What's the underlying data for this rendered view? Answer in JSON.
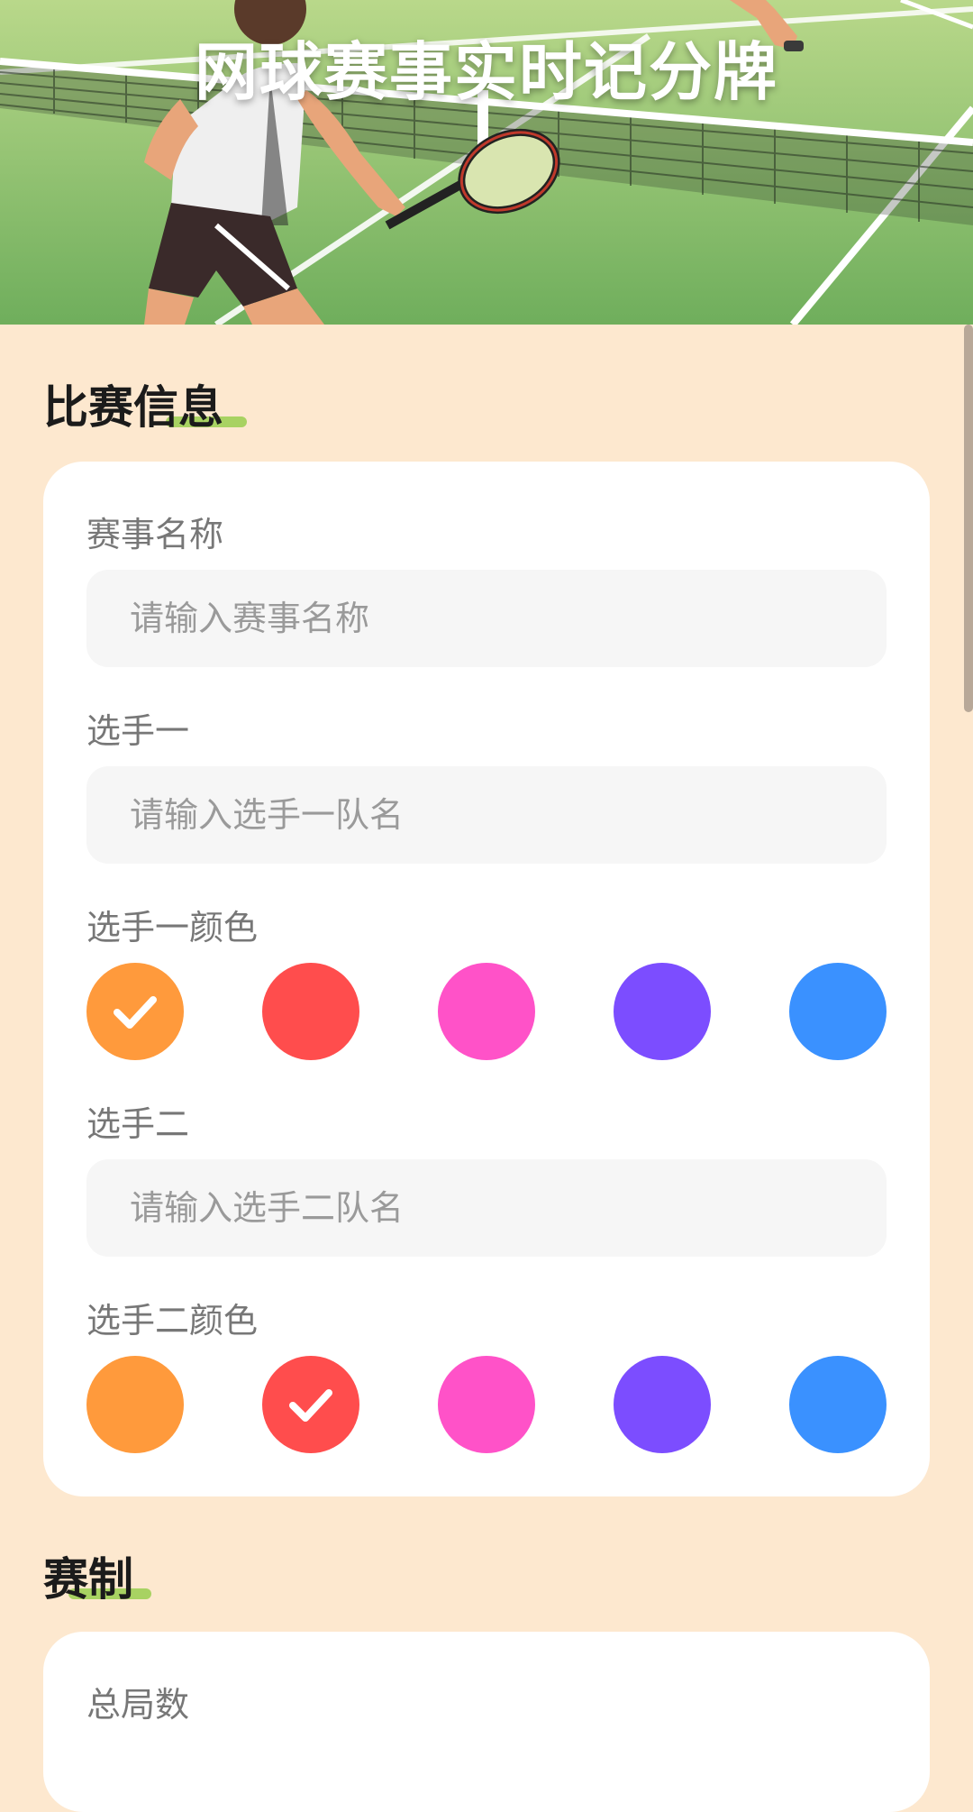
{
  "header": {
    "title": "网球赛事实时记分牌"
  },
  "match_info": {
    "section_title": "比赛信息",
    "event_name": {
      "label": "赛事名称",
      "placeholder": "请输入赛事名称",
      "value": ""
    },
    "player_one": {
      "label": "选手一",
      "placeholder": "请输入选手一队名",
      "value": ""
    },
    "player_one_color": {
      "label": "选手一颜色",
      "options": [
        {
          "name": "orange",
          "hex": "#ff9a3c",
          "selected": true
        },
        {
          "name": "red",
          "hex": "#ff4d4d",
          "selected": false
        },
        {
          "name": "pink",
          "hex": "#ff52c8",
          "selected": false
        },
        {
          "name": "purple",
          "hex": "#7c4dff",
          "selected": false
        },
        {
          "name": "blue",
          "hex": "#3a91ff",
          "selected": false
        }
      ]
    },
    "player_two": {
      "label": "选手二",
      "placeholder": "请输入选手二队名",
      "value": ""
    },
    "player_two_color": {
      "label": "选手二颜色",
      "options": [
        {
          "name": "orange",
          "hex": "#ff9a3c",
          "selected": false
        },
        {
          "name": "red",
          "hex": "#ff4d4d",
          "selected": true
        },
        {
          "name": "pink",
          "hex": "#ff52c8",
          "selected": false
        },
        {
          "name": "purple",
          "hex": "#7c4dff",
          "selected": false
        },
        {
          "name": "blue",
          "hex": "#3a91ff",
          "selected": false
        }
      ]
    }
  },
  "format": {
    "section_title": "赛制",
    "total_games": {
      "label": "总局数"
    }
  },
  "colors": {
    "page_background": "#fde8cf",
    "accent_underline": "#9fcf55",
    "card_background": "#ffffff",
    "input_background": "#f6f6f6"
  }
}
